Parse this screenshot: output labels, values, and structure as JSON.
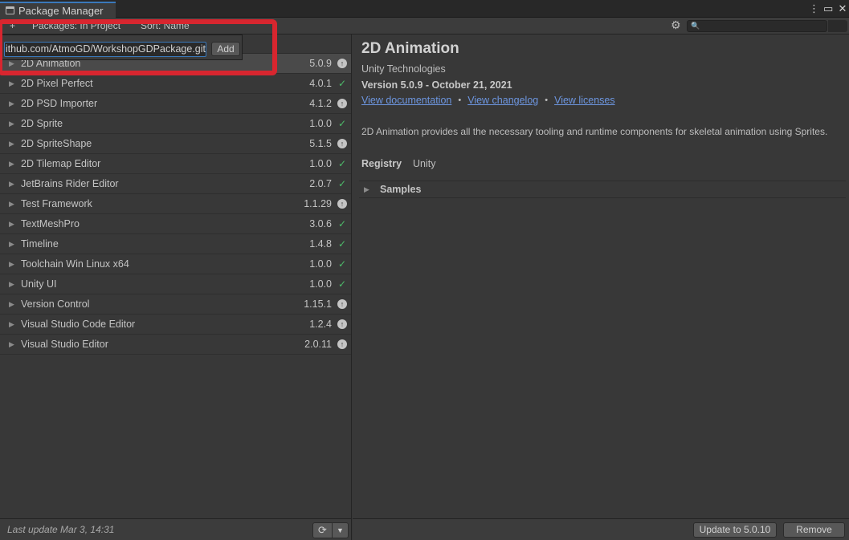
{
  "window": {
    "title": "Package Manager",
    "menu_icon": "kebab-menu-icon",
    "maximize_icon": "maximize-icon",
    "close_icon": "close-icon"
  },
  "toolbar": {
    "add_menu": "+",
    "packages_filter": "Packages: In Project",
    "sort": "Sort: Name",
    "settings_icon": "gear-icon",
    "search_placeholder": "🔍"
  },
  "popup": {
    "url_value": "https://github.com/AtmoGD/WorkshopGDPackage.git",
    "add_label": "Add"
  },
  "packages": [
    {
      "name": "2D Animation",
      "version": "5.0.9",
      "status": "update"
    },
    {
      "name": "2D Pixel Perfect",
      "version": "4.0.1",
      "status": "ok"
    },
    {
      "name": "2D PSD Importer",
      "version": "4.1.2",
      "status": "update"
    },
    {
      "name": "2D Sprite",
      "version": "1.0.0",
      "status": "ok"
    },
    {
      "name": "2D SpriteShape",
      "version": "5.1.5",
      "status": "update"
    },
    {
      "name": "2D Tilemap Editor",
      "version": "1.0.0",
      "status": "ok"
    },
    {
      "name": "JetBrains Rider Editor",
      "version": "2.0.7",
      "status": "ok"
    },
    {
      "name": "Test Framework",
      "version": "1.1.29",
      "status": "update"
    },
    {
      "name": "TextMeshPro",
      "version": "3.0.6",
      "status": "ok"
    },
    {
      "name": "Timeline",
      "version": "1.4.8",
      "status": "ok"
    },
    {
      "name": "Toolchain Win Linux x64",
      "version": "1.0.0",
      "status": "ok"
    },
    {
      "name": "Unity UI",
      "version": "1.0.0",
      "status": "ok"
    },
    {
      "name": "Version Control",
      "version": "1.15.1",
      "status": "update"
    },
    {
      "name": "Visual Studio Code Editor",
      "version": "1.2.4",
      "status": "update"
    },
    {
      "name": "Visual Studio Editor",
      "version": "2.0.11",
      "status": "update"
    }
  ],
  "left_footer": {
    "last_update": "Last update Mar 3, 14:31"
  },
  "details": {
    "title": "2D Animation",
    "author": "Unity Technologies",
    "version_line": "Version 5.0.9 - October 21, 2021",
    "link_docs": "View documentation",
    "link_changelog": "View changelog",
    "link_licenses": "View licenses",
    "description": "2D Animation provides all the necessary tooling and runtime components for skeletal animation using Sprites.",
    "registry_label": "Registry",
    "registry_value": "Unity",
    "samples_label": "Samples"
  },
  "right_footer": {
    "update_label": "Update to 5.0.10",
    "remove_label": "Remove"
  },
  "colors": {
    "highlight": "#d8262f",
    "link": "#6d96e0",
    "check": "#4dbb6a",
    "accent": "#3a79bb"
  }
}
